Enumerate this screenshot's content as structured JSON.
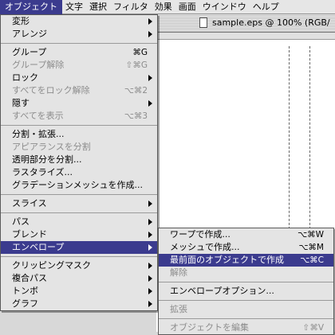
{
  "menubar": {
    "items": [
      "オブジェクト",
      "文字",
      "選択",
      "フィルタ",
      "効果",
      "画面",
      "ウインドウ",
      "ヘルプ"
    ]
  },
  "document": {
    "title": "sample.eps @ 100% (RGB/"
  },
  "object_menu": {
    "groups": [
      [
        {
          "label": "変形",
          "submenu": true
        },
        {
          "label": "アレンジ",
          "submenu": true
        }
      ],
      [
        {
          "label": "グループ",
          "shortcut": "⌘G"
        },
        {
          "label": "グループ解除",
          "shortcut": "⇧⌘G",
          "disabled": true
        },
        {
          "label": "ロック",
          "submenu": true
        },
        {
          "label": "すべてをロック解除",
          "shortcut": "⌥⌘2",
          "disabled": true
        },
        {
          "label": "隠す",
          "submenu": true
        },
        {
          "label": "すべてを表示",
          "shortcut": "⌥⌘3",
          "disabled": true
        }
      ],
      [
        {
          "label": "分割・拡張..."
        },
        {
          "label": "アピアランスを分割",
          "disabled": true
        },
        {
          "label": "透明部分を分割..."
        },
        {
          "label": "ラスタライズ..."
        },
        {
          "label": "グラデーションメッシュを作成..."
        }
      ],
      [
        {
          "label": "スライス",
          "submenu": true
        }
      ],
      [
        {
          "label": "パス",
          "submenu": true
        },
        {
          "label": "ブレンド",
          "submenu": true
        },
        {
          "label": "エンベロープ",
          "submenu": true,
          "highlighted": true
        }
      ],
      [
        {
          "label": "クリッピングマスク",
          "submenu": true
        },
        {
          "label": "複合パス",
          "submenu": true
        },
        {
          "label": "トンボ",
          "submenu": true
        },
        {
          "label": "グラフ",
          "submenu": true
        }
      ]
    ]
  },
  "envelope_menu": {
    "groups": [
      [
        {
          "label": "ワープで作成...",
          "shortcut": "⌥⌘W"
        },
        {
          "label": "メッシュで作成...",
          "shortcut": "⌥⌘M"
        },
        {
          "label": "最前面のオブジェクトで作成",
          "shortcut": "⌥⌘C",
          "highlighted": true
        },
        {
          "label": "解除",
          "disabled": true
        }
      ],
      [
        {
          "label": "エンベロープオプション..."
        }
      ],
      [
        {
          "label": "拡張",
          "disabled": true
        }
      ],
      [
        {
          "label": "オブジェクトを編集",
          "shortcut": "⇧⌘V",
          "disabled": true
        }
      ]
    ]
  },
  "colors": {
    "highlight": "#3b3b8e",
    "menu_bg": "#e4e4e4",
    "disabled_text": "#8c8c8c"
  }
}
